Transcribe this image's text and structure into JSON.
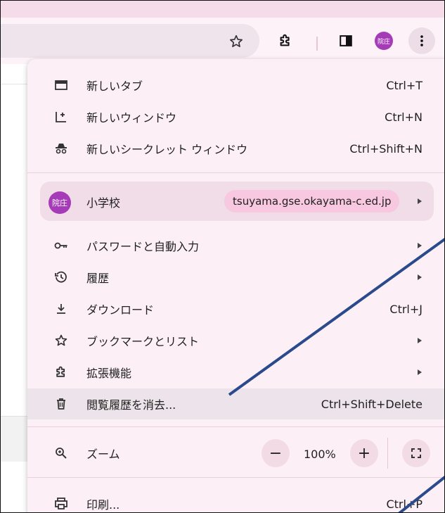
{
  "toolbar": {
    "avatar_text": "院庄",
    "icons": [
      "star-icon",
      "extension-icon",
      "side-panel-icon",
      "avatar",
      "more-vert-icon"
    ]
  },
  "menu": {
    "items_top": [
      {
        "label": "新しいタブ",
        "shortcut": "Ctrl+T",
        "icon": "new-tab-icon"
      },
      {
        "label": "新しいウィンドウ",
        "shortcut": "Ctrl+N",
        "icon": "new-window-icon"
      },
      {
        "label": "新しいシークレット ウィンドウ",
        "shortcut": "Ctrl+Shift+N",
        "icon": "incognito-icon"
      }
    ],
    "profile": {
      "avatar_text": "院庄",
      "name": "小学校",
      "email": "tsuyama.gse.okayama-c.ed.jp"
    },
    "items_mid": [
      {
        "label": "パスワードと自動入力",
        "shortcut": "",
        "icon": "key-icon",
        "submenu": true
      },
      {
        "label": "履歴",
        "shortcut": "",
        "icon": "history-icon",
        "submenu": true
      },
      {
        "label": "ダウンロード",
        "shortcut": "Ctrl+J",
        "icon": "download-icon",
        "submenu": false
      },
      {
        "label": "ブックマークとリスト",
        "shortcut": "",
        "icon": "star-icon",
        "submenu": true
      },
      {
        "label": "拡張機能",
        "shortcut": "",
        "icon": "extension-icon",
        "submenu": true
      },
      {
        "label": "閲覧履歴を消去...",
        "shortcut": "Ctrl+Shift+Delete",
        "icon": "trash-icon",
        "submenu": false,
        "highlighted": true
      }
    ],
    "zoom": {
      "label": "ズーム",
      "minus": "−",
      "value": "100%",
      "plus": "+"
    },
    "print": {
      "label": "印刷...",
      "shortcut": "Ctrl+P"
    }
  },
  "colors": {
    "accent": "#a63bb7",
    "menu_bg": "#fcf0f6",
    "annotation": "#2b4a8b"
  }
}
